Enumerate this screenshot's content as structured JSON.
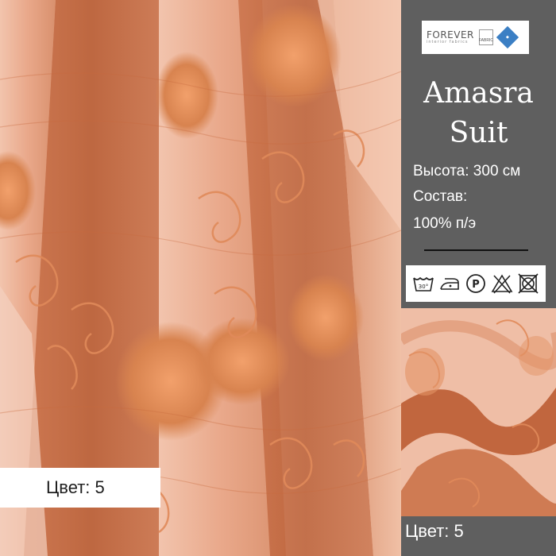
{
  "brand": {
    "name": "FOREVER",
    "tagline": "interior fabrics",
    "secondary_mark": "FABRIC"
  },
  "product": {
    "name_line1": "Amasra",
    "name_line2": "Suit",
    "height": "Высота: 300 см",
    "composition_label": "Состав:",
    "composition_value": "100% п/э"
  },
  "care_symbols": [
    "wash-30-icon",
    "iron-low-icon",
    "dry-clean-p-icon",
    "no-bleach-icon",
    "no-tumble-dry-icon"
  ],
  "care_wash_temp": "30°",
  "color_label": "Цвет: 5",
  "colors": {
    "panel_bg": "#5f5f5f",
    "fabric_light": "#efb89e",
    "fabric_mid": "#d68a66",
    "fabric_dark": "#b0562e",
    "embroidery": "#e08a5a"
  }
}
